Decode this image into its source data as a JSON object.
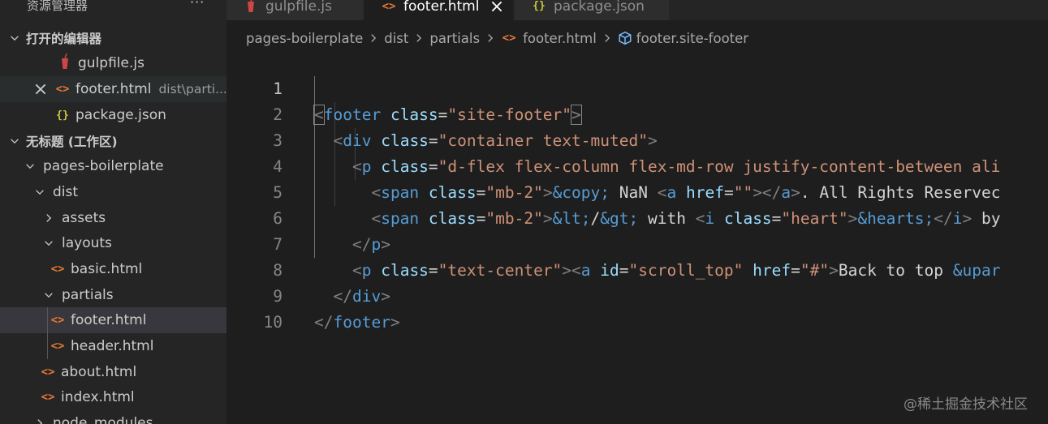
{
  "explorer": {
    "title": "资源管理器",
    "more": "···",
    "open_editors": {
      "label": "打开的编辑器",
      "items": [
        {
          "name": "gulpfile.js",
          "desc": ""
        },
        {
          "name": "footer.html",
          "desc": "dist\\parti..."
        },
        {
          "name": "package.json",
          "desc": ""
        }
      ]
    },
    "workspace": {
      "label": "无标题 (工作区)",
      "tree": [
        {
          "name": "pages-boilerplate"
        },
        {
          "name": "dist"
        },
        {
          "name": "assets"
        },
        {
          "name": "layouts"
        },
        {
          "name": "basic.html"
        },
        {
          "name": "partials"
        },
        {
          "name": "footer.html"
        },
        {
          "name": "header.html"
        },
        {
          "name": "about.html"
        },
        {
          "name": "index.html"
        },
        {
          "name": "node_modules"
        }
      ]
    }
  },
  "tabs": [
    {
      "label": "gulpfile.js"
    },
    {
      "label": "footer.html"
    },
    {
      "label": "package.json"
    }
  ],
  "breadcrumb": {
    "items": [
      "pages-boilerplate",
      "dist",
      "partials",
      "footer.html",
      "footer.site-footer"
    ]
  },
  "editor": {
    "line_numbers": [
      "1",
      "2",
      "3",
      "4",
      "5",
      "6",
      "7",
      "8",
      "9",
      "10"
    ],
    "current_line": "1"
  },
  "watermark": "@稀土掘金技术社区",
  "colors": {
    "editor_bg": "#1e1e1e",
    "sidebar_bg": "#252526",
    "tag": "#569cd6",
    "attribute": "#9cdcfe",
    "string": "#ce9178",
    "html_icon": "#e37933",
    "json_icon": "#cbcb41"
  }
}
